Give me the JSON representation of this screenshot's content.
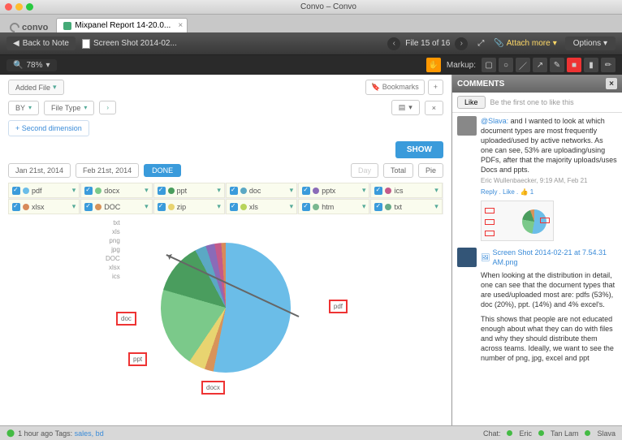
{
  "window": {
    "title": "Convo – Convo"
  },
  "tabs": [
    {
      "label": "Mixpanel Report 14-20.0...",
      "close": "×"
    }
  ],
  "logo": "convo",
  "toolbar": {
    "back": "Back to Note",
    "file_title": "Screen Shot 2014-02...",
    "file_nav": "File 15 of 16",
    "attach": "Attach more",
    "options": "Options"
  },
  "toolbar2": {
    "zoom": "78%",
    "markup": "Markup:"
  },
  "report": {
    "added_file": "Added File",
    "bookmarks": "Bookmarks",
    "by": "BY",
    "file_type": "File Type",
    "second_dimension": "+ Second dimension",
    "show": "SHOW",
    "date_from": "Jan 21st, 2014",
    "date_to": "Feb 21st, 2014",
    "done": "DONE",
    "view_day": "Day",
    "view_total": "Total",
    "view_pie": "Pie"
  },
  "series": [
    {
      "name": "pdf",
      "color": "#6bbde8"
    },
    {
      "name": "docx",
      "color": "#7bc98a"
    },
    {
      "name": "ppt",
      "color": "#4a9d5e"
    },
    {
      "name": "doc",
      "color": "#5ba8c4"
    },
    {
      "name": "pptx",
      "color": "#8a6bb8"
    },
    {
      "name": "ics",
      "color": "#c45a8a"
    },
    {
      "name": "xlsx",
      "color": "#d88a5a"
    },
    {
      "name": "DOC",
      "color": "#d8935a"
    },
    {
      "name": "zip",
      "color": "#e8d470"
    },
    {
      "name": "xls",
      "color": "#b8d45a"
    },
    {
      "name": "htm",
      "color": "#7ab890"
    },
    {
      "name": "txt",
      "color": "#6a8"
    }
  ],
  "chart_labels": [
    "txt",
    "xls",
    "png",
    "jpg",
    "DOC",
    "xlsx",
    "ics"
  ],
  "annotations": {
    "pdf": "pdf",
    "doc": "doc",
    "ppt": "ppt",
    "docx": "docx"
  },
  "chart_data": {
    "type": "pie",
    "title": "",
    "categories": [
      "pdf",
      "docx",
      "ppt",
      "doc",
      "pptx",
      "ics",
      "xlsx",
      "DOC",
      "zip",
      "xls",
      "htm",
      "txt",
      "png",
      "jpg"
    ],
    "values": [
      53,
      20,
      13,
      3,
      3,
      1,
      4,
      1,
      1,
      1,
      0,
      0,
      0,
      0
    ],
    "unit": "percent"
  },
  "comments": {
    "header": "COMMENTS",
    "like": "Like",
    "like_prompt": "Be the first one to like this",
    "c1": {
      "mention": "@Slava:",
      "body": " and I wanted to look at which document types are most frequently uploaded/used by active networks. As one can see, 53% are uploading/using PDFs, after that the majority uploads/uses Docs and ppts.",
      "author": "Eric Wullenbaecker",
      "time": "9:19 AM, Feb 21",
      "reply": "Reply",
      "like": "Like",
      "like_icon": "👍",
      "count": "1"
    },
    "c2": {
      "attachment": "Screen Shot 2014-02-21 at 7.54.31 AM.png",
      "body1": "When looking at the distribution in detail, one can see that the document types that are used/uploaded most are: pdfs (53%), doc (20%), ppt. (14%) and 4% excel's.",
      "body2": "This shows that people are not educated enough about what they can do with files and why they should distribute them across teams. Ideally, we want to see the number of png, jpg, excel and ppt"
    }
  },
  "status": {
    "time": "1 hour ago",
    "tags_label": "Tags:",
    "tags": "sales, bd",
    "chat": "Chat:",
    "users": [
      "Eric",
      "Tan Lam",
      "Slava"
    ]
  }
}
